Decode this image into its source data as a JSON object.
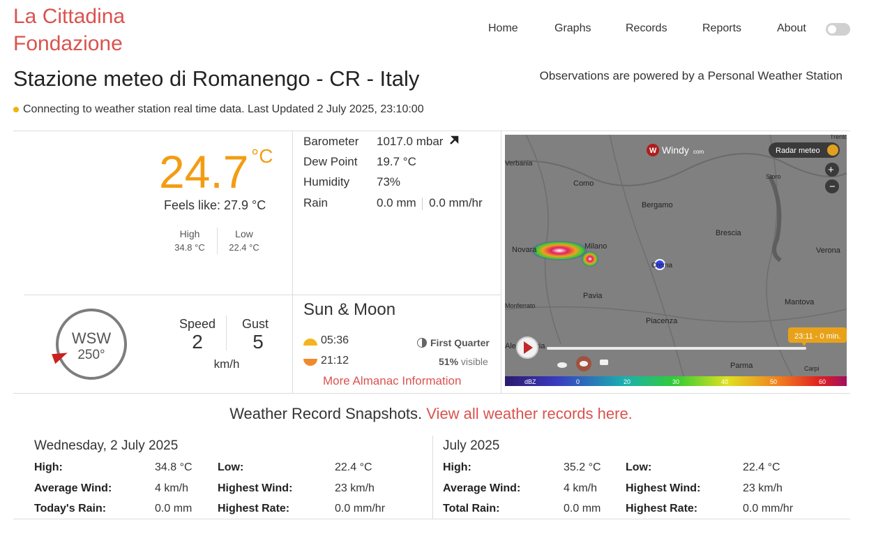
{
  "brand": {
    "line1": "La Cittadina",
    "line2": "Fondazione",
    "color": "#d9534f"
  },
  "nav": [
    "Home",
    "Graphs",
    "Records",
    "Reports",
    "About"
  ],
  "station": {
    "title": "Stazione meteo di Romanengo - CR - Italy",
    "powered": "Observations are powered by a Personal Weather Station",
    "status": "Connecting to weather station real time data. Last Updated 2 July 2025, 23:10:00"
  },
  "current": {
    "temp": "24.7",
    "unit": "°C",
    "feels": "Feels like: 27.9 °C",
    "high_label": "High",
    "high_value": "34.8 °C",
    "low_label": "Low",
    "low_value": "22.4 °C"
  },
  "conditions": {
    "barometer_label": "Barometer",
    "barometer_value": "1017.0 mbar",
    "barometer_trend": "arrow-up-right-icon",
    "dewpoint_label": "Dew Point",
    "dewpoint_value": "19.7 °C",
    "humidity_label": "Humidity",
    "humidity_value": "73%",
    "rain_label": "Rain",
    "rain_value": "0.0 mm",
    "rain_rate": "0.0 mm/hr"
  },
  "wind": {
    "direction": "WSW",
    "degrees": "250°",
    "speed_label": "Speed",
    "speed_value": "2",
    "gust_label": "Gust",
    "gust_value": "5",
    "unit": "km/h"
  },
  "sunmoon": {
    "title": "Sun & Moon",
    "sunrise": "05:36",
    "sunset": "21:12",
    "phase": "First Quarter",
    "visible_pct": "51%",
    "visible_text": "visible",
    "almanac_link": "More Almanac Information"
  },
  "map": {
    "logo": "Windy",
    "logo_suffix": "com",
    "layer": "Radar meteo",
    "time": "23:11 - 0 min.",
    "cities": [
      "Verbania",
      "Como",
      "Bergamo",
      "Storo",
      "Brescia",
      "Novara",
      "Milano",
      "Verona",
      "Crema",
      "Pavia",
      "Monferrato",
      "Mantova",
      "Piacenza",
      "Alessandria",
      "Parma",
      "Carpi",
      "Trento"
    ],
    "scale_label": "dBZ",
    "scale_ticks": [
      "0",
      "20",
      "30",
      "40",
      "50",
      "60"
    ]
  },
  "records": {
    "title": "Weather Record Snapshots.",
    "link": "View all weather records here.",
    "today": {
      "heading": "Wednesday, 2 July 2025",
      "high_label": "High:",
      "high": "34.8 °C",
      "low_label": "Low:",
      "low": "22.4 °C",
      "avgwind_label": "Average Wind:",
      "avgwind": "4 km/h",
      "hiwind_label": "Highest Wind:",
      "hiwind": "23 km/h",
      "rain_label": "Today's Rain:",
      "rain": "0.0 mm",
      "rate_label": "Highest Rate:",
      "rate": "0.0 mm/hr"
    },
    "month": {
      "heading": "July 2025",
      "high_label": "High:",
      "high": "35.2 °C",
      "low_label": "Low:",
      "low": "22.4 °C",
      "avgwind_label": "Average Wind:",
      "avgwind": "4 km/h",
      "hiwind_label": "Highest Wind:",
      "hiwind": "23 km/h",
      "rain_label": "Total Rain:",
      "rain": "0.0 mm",
      "rate_label": "Highest Rate:",
      "rate": "0.0 mm/hr"
    }
  },
  "colors": {
    "temp": "#f39c12",
    "accent": "#d9534f",
    "status_dot": "#f0b400",
    "wind_needle": "#cc1f1f"
  }
}
